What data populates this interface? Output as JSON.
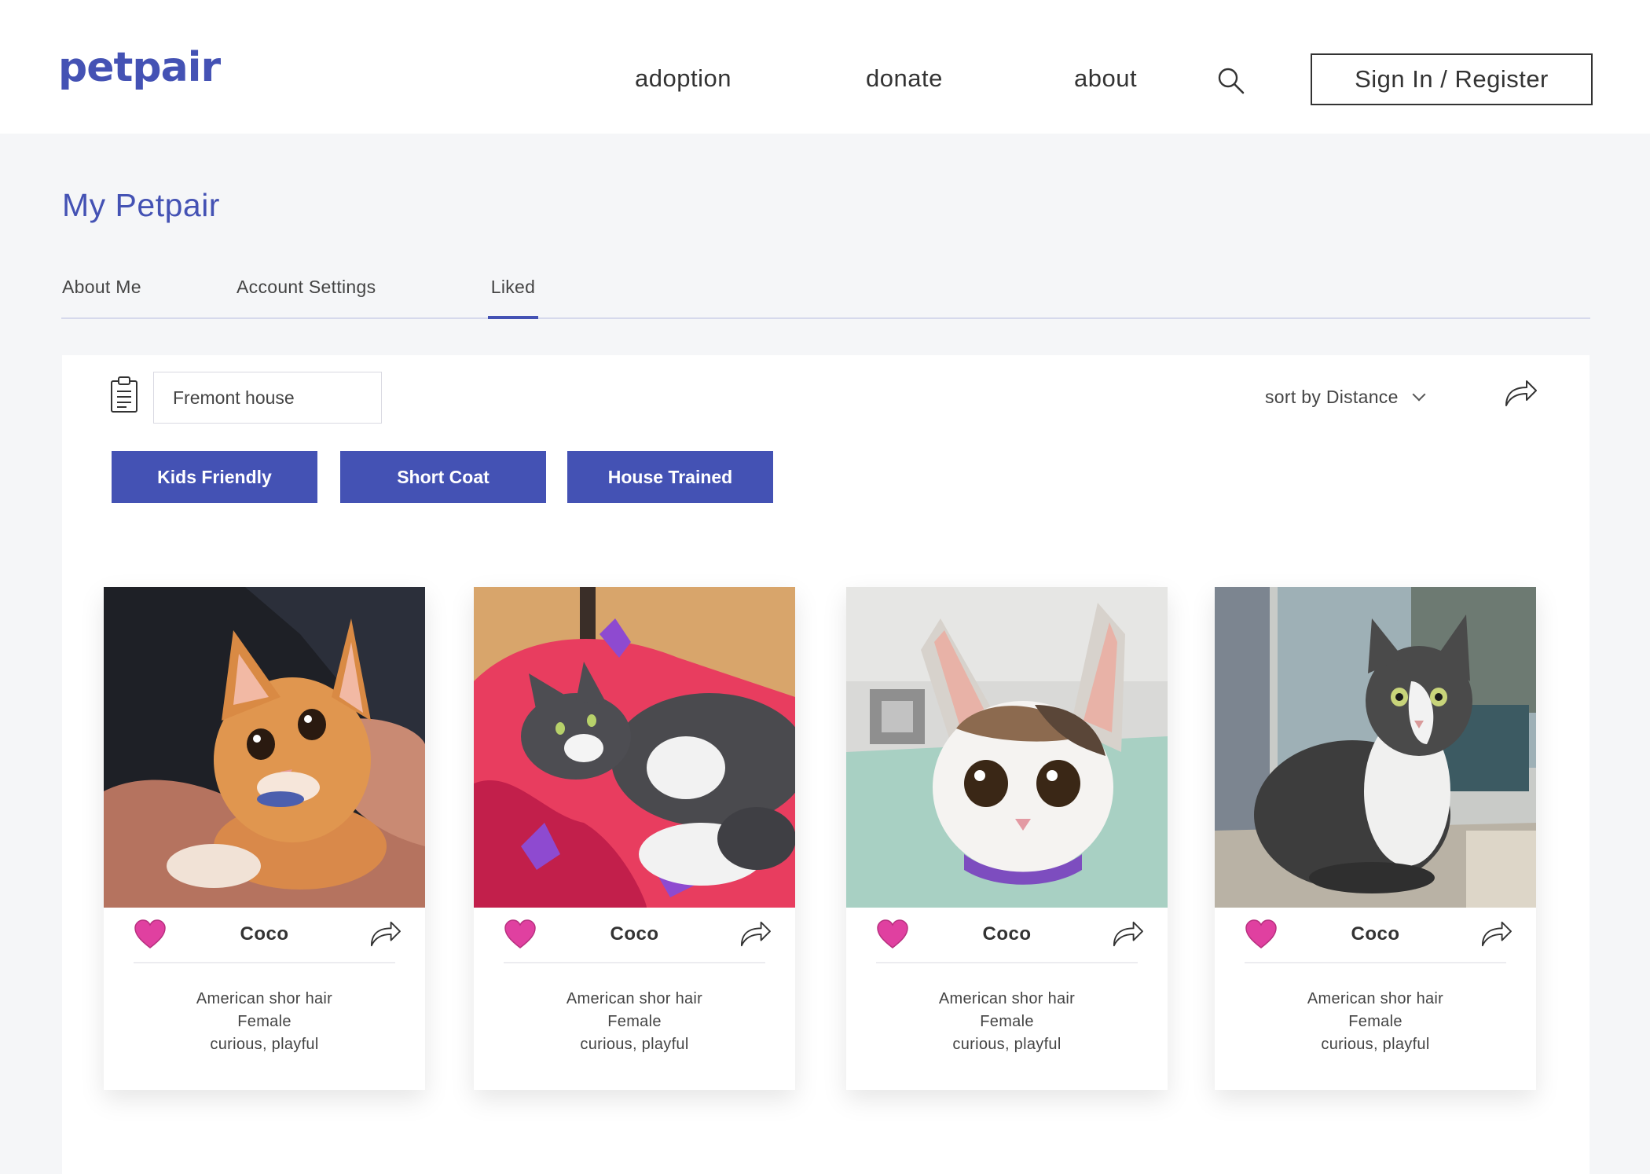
{
  "brand": {
    "logo": "petpair",
    "accent": "#4452b4"
  },
  "nav": {
    "links": [
      "adoption",
      "donate",
      "about"
    ],
    "search_icon": "search-icon",
    "signin_label": "Sign In / Register"
  },
  "page": {
    "title": "My Petpair",
    "tabs": [
      {
        "label": "About Me",
        "active": false
      },
      {
        "label": "Account Settings",
        "active": false
      },
      {
        "label": "Liked",
        "active": true
      }
    ]
  },
  "toolbar": {
    "list_icon": "clipboard-icon",
    "list_name": "Fremont house",
    "sort_label": "sort by Distance",
    "share_icon": "share-icon"
  },
  "tags": [
    "Kids Friendly",
    "Short Coat",
    "House Trained"
  ],
  "pets": [
    {
      "name": "Coco",
      "breed": "American shor hair",
      "sex": "Female",
      "traits": "curious, playful",
      "liked": true
    },
    {
      "name": "Coco",
      "breed": "American shor hair",
      "sex": "Female",
      "traits": "curious, playful",
      "liked": true
    },
    {
      "name": "Coco",
      "breed": "American shor hair",
      "sex": "Female",
      "traits": "curious, playful",
      "liked": true
    },
    {
      "name": "Coco",
      "breed": "American shor hair",
      "sex": "Female",
      "traits": "curious, playful",
      "liked": true
    }
  ],
  "colors": {
    "heart": "#e040a0",
    "tag_bg": "#4452b4",
    "page_bg": "#f5f6f8"
  }
}
